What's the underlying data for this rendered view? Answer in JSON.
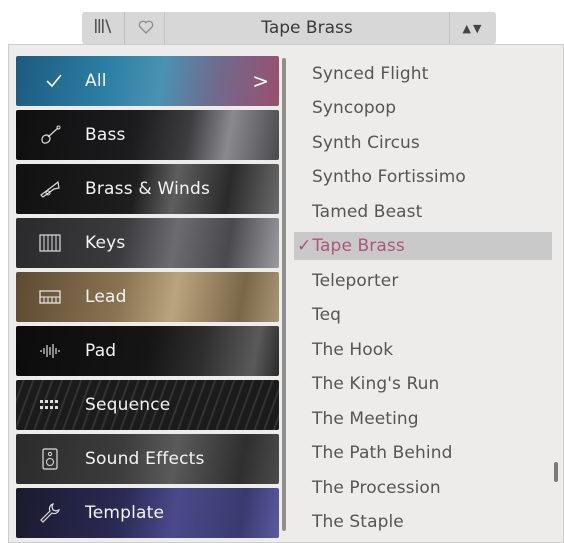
{
  "header": {
    "preset_name": "Tape Brass",
    "browse_icon": "library-icon",
    "favorite_icon": "heart-icon",
    "nav_arrows": "▲▼"
  },
  "categories": [
    {
      "label": "All",
      "icon": "checkmark-icon",
      "selected": true,
      "chevron": ">"
    },
    {
      "label": "Bass",
      "icon": "bass-guitar-icon"
    },
    {
      "label": "Brass & Winds",
      "icon": "trumpet-icon"
    },
    {
      "label": "Keys",
      "icon": "piano-keys-icon"
    },
    {
      "label": "Lead",
      "icon": "synth-keyboard-icon"
    },
    {
      "label": "Pad",
      "icon": "waveform-icon"
    },
    {
      "label": "Sequence",
      "icon": "step-grid-icon"
    },
    {
      "label": "Sound Effects",
      "icon": "speaker-icon"
    },
    {
      "label": "Template",
      "icon": "wrench-icon"
    }
  ],
  "presets": [
    {
      "label": "Synced Flight"
    },
    {
      "label": "Syncopop"
    },
    {
      "label": "Synth Circus"
    },
    {
      "label": "Syntho Fortissimo"
    },
    {
      "label": "Tamed Beast"
    },
    {
      "label": "Tape Brass",
      "selected": true,
      "check": "✓"
    },
    {
      "label": "Teleporter"
    },
    {
      "label": "Teq"
    },
    {
      "label": "The Hook"
    },
    {
      "label": "The King's Run"
    },
    {
      "label": "The Meeting"
    },
    {
      "label": "The Path Behind"
    },
    {
      "label": "The Procession"
    },
    {
      "label": "The Staple"
    }
  ],
  "colors": {
    "selected_text": "#a9577f",
    "selected_bg": "#c9c9c9",
    "list_text": "#555555"
  }
}
